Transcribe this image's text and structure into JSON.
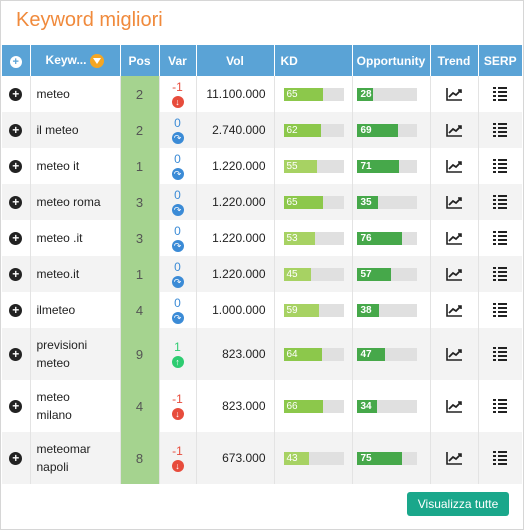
{
  "title": "Keyword migliori",
  "colors": {
    "accent": "#f08a3c",
    "header": "#5aa3d6",
    "pos": "#a5d38f",
    "button": "#1aa78b",
    "down": "#e74c3c",
    "up": "#2ecc71",
    "same": "#3b8bd6"
  },
  "headers": {
    "keyword": "Keyw...",
    "pos": "Pos",
    "var": "Var",
    "vol": "Vol",
    "kd": "KD",
    "opportunity": "Opportunity",
    "trend": "Trend",
    "serp": "SERP"
  },
  "rows": [
    {
      "keyword": "meteo",
      "pos": "2",
      "var": "-1",
      "dir": "down",
      "vol": "11.100.000",
      "kd": 65,
      "kd_label": "65",
      "opp": 28,
      "opp_label": "28"
    },
    {
      "keyword": "il meteo",
      "pos": "2",
      "var": "0",
      "dir": "same",
      "vol": "2.740.000",
      "kd": 62,
      "kd_label": "62",
      "opp": 69,
      "opp_label": "69"
    },
    {
      "keyword": "meteo it",
      "pos": "1",
      "var": "0",
      "dir": "same",
      "vol": "1.220.000",
      "kd": 55,
      "kd_label": "55",
      "opp": 71,
      "opp_label": "71"
    },
    {
      "keyword": "meteo roma",
      "pos": "3",
      "var": "0",
      "dir": "same",
      "vol": "1.220.000",
      "kd": 65,
      "kd_label": "65",
      "opp": 35,
      "opp_label": "35"
    },
    {
      "keyword": "meteo .it",
      "pos": "3",
      "var": "0",
      "dir": "same",
      "vol": "1.220.000",
      "kd": 53,
      "kd_label": "53",
      "opp": 76,
      "opp_label": "76"
    },
    {
      "keyword": "meteo.it",
      "pos": "1",
      "var": "0",
      "dir": "same",
      "vol": "1.220.000",
      "kd": 45,
      "kd_label": "45",
      "opp": 57,
      "opp_label": "57"
    },
    {
      "keyword": "ilmeteo",
      "pos": "4",
      "var": "0",
      "dir": "same",
      "vol": "1.000.000",
      "kd": 59,
      "kd_label": "59",
      "opp": 38,
      "opp_label": "38"
    },
    {
      "keyword": "previsioni meteo",
      "pos": "9",
      "var": "1",
      "dir": "up",
      "vol": "823.000",
      "kd": 64,
      "kd_label": "64",
      "opp": 47,
      "opp_label": "47"
    },
    {
      "keyword": "meteo milano",
      "pos": "4",
      "var": "-1",
      "dir": "down",
      "vol": "823.000",
      "kd": 66,
      "kd_label": "66",
      "opp": 34,
      "opp_label": "34"
    },
    {
      "keyword": "meteomar napoli",
      "pos": "8",
      "var": "-1",
      "dir": "down",
      "vol": "673.000",
      "kd": 43,
      "kd_label": "43",
      "opp": 75,
      "opp_label": "75"
    }
  ],
  "button": {
    "label": "Visualizza tutte"
  },
  "icons": {
    "expand": "plus-circle-icon",
    "filter": "filter-icon",
    "trend": "trend-chart-icon",
    "serp": "serp-list-icon"
  }
}
